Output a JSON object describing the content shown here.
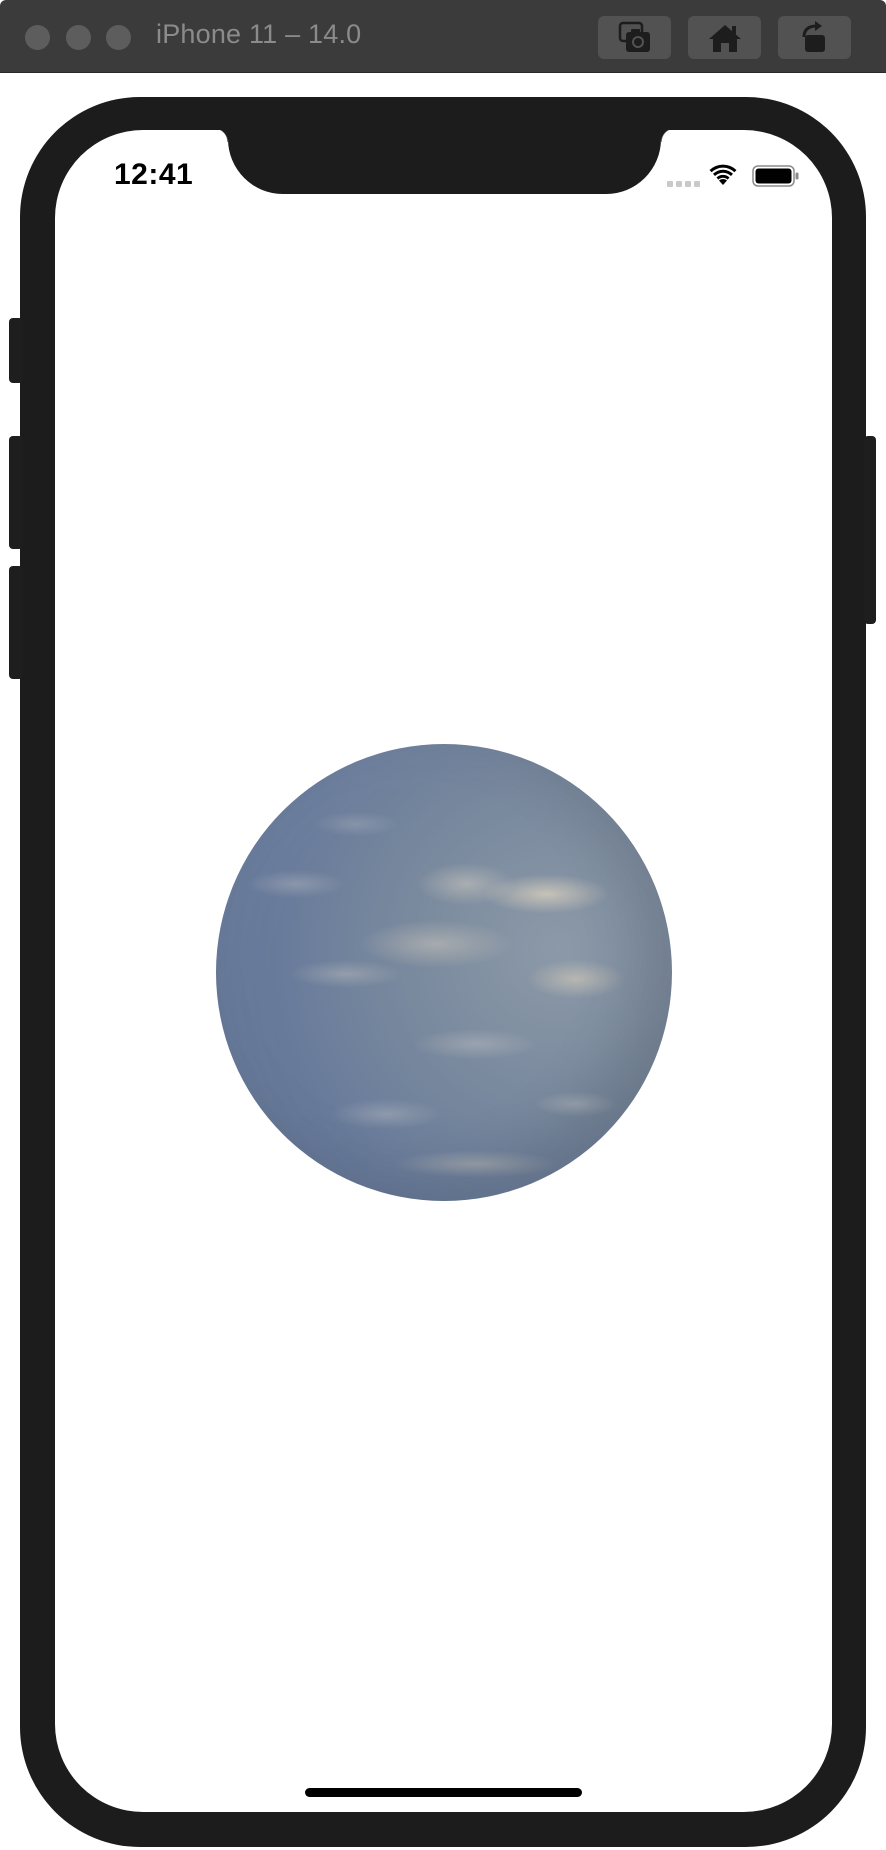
{
  "window": {
    "title": "iPhone 11 – 14.0",
    "buttons": [
      {
        "icon": "screenshot-camera-icon"
      },
      {
        "icon": "home-icon"
      },
      {
        "icon": "rotate-icon"
      }
    ]
  },
  "status_bar": {
    "time": "12:41",
    "signal_icon": "cellular-signal-icon",
    "wifi_icon": "wifi-icon",
    "battery_icon": "battery-icon",
    "battery_level": 1.0
  },
  "content": {
    "object": "textured-sphere",
    "colors": {
      "sky_blue": "#6b7f9f",
      "cloud": "#d8cfbf",
      "device_frame": "#1c1c1c",
      "titlebar": "#3b3b3b"
    }
  }
}
